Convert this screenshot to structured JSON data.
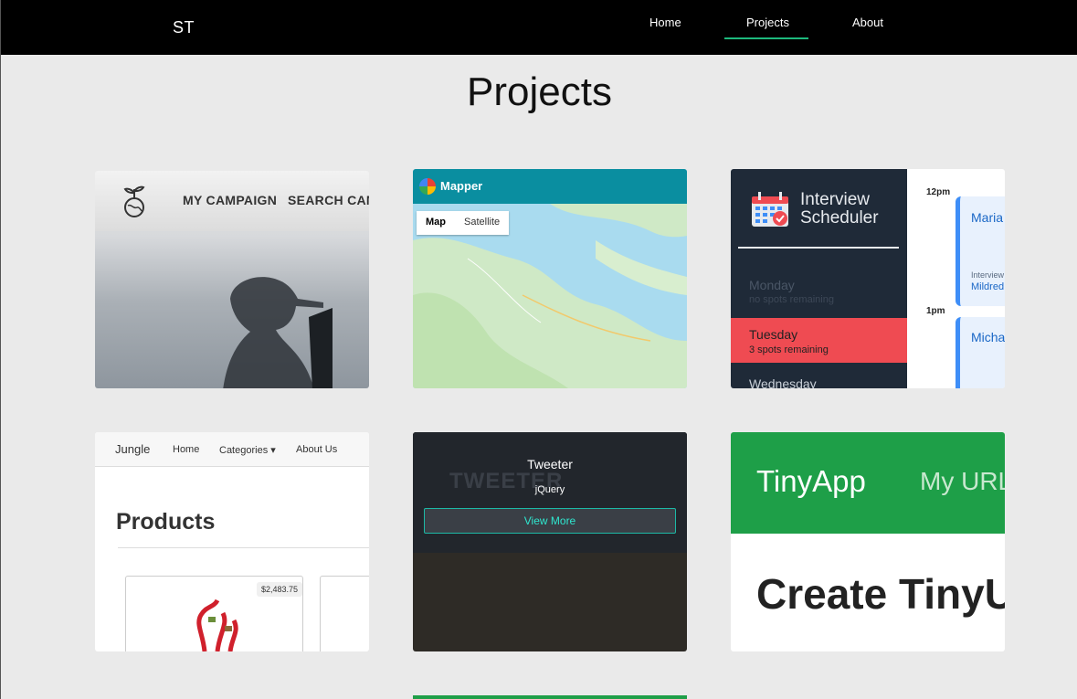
{
  "nav": {
    "brand": "ST",
    "links": [
      "Home",
      "Projects",
      "About"
    ],
    "active": "Projects",
    "accent_color": "#1db97d"
  },
  "page": {
    "title": "Projects"
  },
  "projects": [
    {
      "thumb": {
        "menu": [
          "MY CAMPAIGN",
          "SEARCH CAM"
        ]
      }
    },
    {
      "thumb": {
        "app": "Mapper",
        "tabs": [
          "Map",
          "Satellite"
        ]
      }
    },
    {
      "thumb": {
        "title_line1": "Interview",
        "title_line2": "Scheduler",
        "days": [
          {
            "day": "Monday",
            "spots": "no spots remaining"
          },
          {
            "day": "Tuesday",
            "spots": "3 spots remaining"
          },
          {
            "day": "Wednesday",
            "spots": ""
          }
        ],
        "times": [
          "12pm",
          "1pm"
        ],
        "appointments": [
          "Maria",
          "Micha"
        ],
        "interviewer_label": "Interview",
        "interviewer_name": "Mildred"
      }
    },
    {
      "thumb": {
        "brand": "Jungle",
        "nav": [
          "Home",
          "Categories ▾",
          "About Us"
        ],
        "heading": "Products",
        "price": "$2,483.75"
      }
    },
    {
      "overlay": {
        "name": "Tweeter",
        "tech": "jQuery",
        "button": "View More",
        "ghost_logo": "TWEETER"
      }
    },
    {
      "thumb": {
        "logo": "TinyApp",
        "nav": "My URL",
        "heading": "Create TinyU"
      }
    }
  ]
}
